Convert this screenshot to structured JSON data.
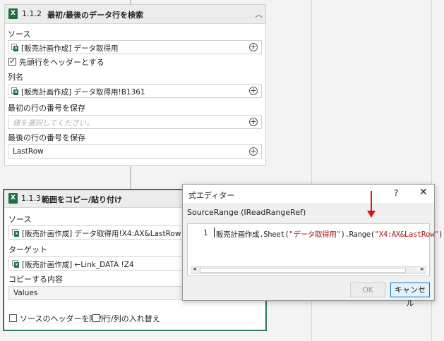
{
  "card1": {
    "number": "1.1.2",
    "title": "最初/最後のデータ行を検索",
    "source_label": "ソース",
    "source_value": "[販売計画作成] データ取得用",
    "header_checkbox_label": "先頭行をヘッダーとする",
    "header_checkbox_checked": true,
    "column_label": "列名",
    "column_value": "[販売計画作成] データ取得用!B1361",
    "first_row_label": "最初の行の番号を保存",
    "first_row_placeholder": "値を選択してください。",
    "last_row_label": "最後の行の番号を保存",
    "last_row_value": "LastRow"
  },
  "card2": {
    "number": "1.1.3",
    "title": "範囲をコピー/貼り付け",
    "source_label": "ソース",
    "source_value": "[販売計画作成] データ取得用!X4:AX&LastRow",
    "target_label": "ターゲット",
    "target_value": "[販売計画作成] ←Link_DATA !Z4",
    "copy_content_label": "コピーする内容",
    "copy_content_value": "Values",
    "exclude_header_label": "ソースのヘッダーを除外",
    "transpose_label": "行/列の入れ替え"
  },
  "dialog": {
    "title": "式エディター",
    "help": "?",
    "close": "✕",
    "subtitle": "SourceRange (IReadRangeRef)",
    "line_number": "1",
    "code_part1": "販売計画作成.Sheet(",
    "code_str1": "\"データ取得用\"",
    "code_part2": ").Range(",
    "code_str2": "\"X4:AX&LastRow\"",
    "code_part3": ")",
    "ok_label": "OK",
    "cancel_label": "キャンセル"
  },
  "icons": {
    "excel": "excel-icon",
    "collapse": "chevron-up-icon",
    "add": "plus-circle-icon",
    "arrow": "red-arrow-down"
  },
  "colors": {
    "active_border": "#2b7a5e",
    "excel_green": "#1d6f42",
    "string_red": "#a31515",
    "annotation_red": "#d9151b"
  }
}
